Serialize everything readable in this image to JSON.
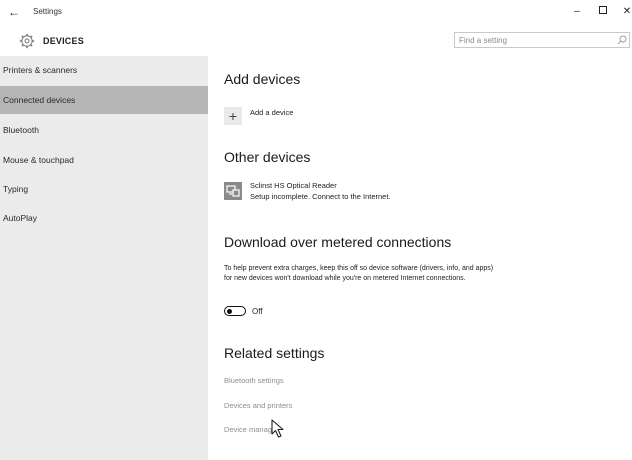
{
  "window": {
    "title": "Settings",
    "back_glyph": "←",
    "minimize_glyph": "–",
    "close_glyph": "✕"
  },
  "header": {
    "title": "DEVICES",
    "icon": "gear-icon",
    "search": {
      "placeholder": "Find a setting",
      "value": "",
      "icon": "search-icon"
    }
  },
  "sidebar": {
    "selected_index": 1,
    "items": [
      {
        "label": "Printers & scanners"
      },
      {
        "label": "Connected devices"
      },
      {
        "label": "Bluetooth"
      },
      {
        "label": "Mouse & touchpad"
      },
      {
        "label": "Typing"
      },
      {
        "label": "AutoPlay"
      }
    ]
  },
  "main": {
    "add_devices": {
      "title": "Add devices",
      "add_label": "Add a device",
      "add_glyph": "+"
    },
    "other_devices": {
      "title": "Other devices",
      "device": {
        "name": "Sclinst HS Optical Reader",
        "status": "Setup incomplete. Connect to the Internet.",
        "icon": "device-icon"
      }
    },
    "metered": {
      "title": "Download over metered connections",
      "description": "To help prevent extra charges, keep this off so device software (drivers, info, and apps) for new devices won't download while you're on metered Internet connections.",
      "toggle_label": "Off",
      "toggle_on": false
    },
    "related": {
      "title": "Related settings",
      "links": [
        {
          "label": "Bluetooth settings"
        },
        {
          "label": "Devices and printers"
        },
        {
          "label": "Device manager"
        }
      ]
    }
  },
  "colors": {
    "sidebar_bg": "#ebebeb",
    "sidebar_selected": "#b5b5b5",
    "link": "#8e8e8e"
  }
}
